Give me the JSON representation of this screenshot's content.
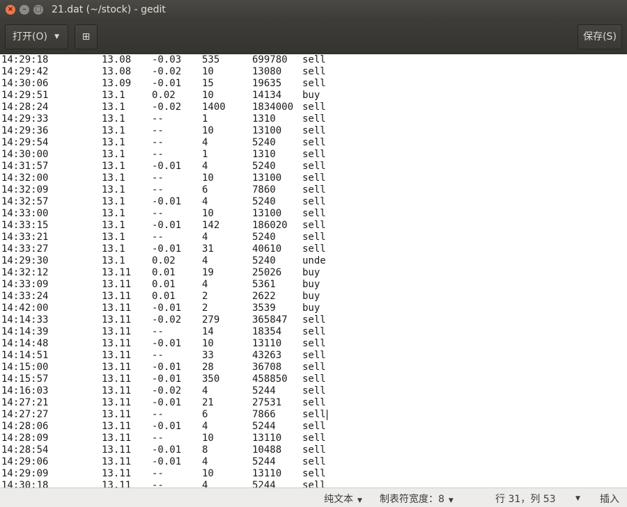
{
  "window": {
    "title": "21.dat (~/stock) - gedit",
    "close_glyph": "×",
    "min_glyph": "–",
    "max_glyph": "□"
  },
  "toolbar": {
    "open_label": "打开(O)",
    "dropdown_glyph": "▼",
    "new_tab_glyph": "⊞",
    "save_label": "保存(S)"
  },
  "editor": {
    "cursor": {
      "line": 31,
      "column": 53
    },
    "lines": [
      [
        "14:29:18",
        "13.08",
        "-0.03",
        "535",
        "699780",
        "sell"
      ],
      [
        "14:29:42",
        "13.08",
        "-0.02",
        "10",
        "13080",
        "sell"
      ],
      [
        "14:30:06",
        "13.09",
        "-0.01",
        "15",
        "19635",
        "sell"
      ],
      [
        "14:29:51",
        "13.1",
        "0.02",
        "10",
        "14134",
        "buy"
      ],
      [
        "14:28:24",
        "13.1",
        "-0.02",
        "1400",
        "1834000",
        "sell"
      ],
      [
        "14:29:33",
        "13.1",
        "--",
        "1",
        "1310",
        "sell"
      ],
      [
        "14:29:36",
        "13.1",
        "--",
        "10",
        "13100",
        "sell"
      ],
      [
        "14:29:54",
        "13.1",
        "--",
        "4",
        "5240",
        "sell"
      ],
      [
        "14:30:00",
        "13.1",
        "--",
        "1",
        "1310",
        "sell"
      ],
      [
        "14:31:57",
        "13.1",
        "-0.01",
        "4",
        "5240",
        "sell"
      ],
      [
        "14:32:00",
        "13.1",
        "--",
        "10",
        "13100",
        "sell"
      ],
      [
        "14:32:09",
        "13.1",
        "--",
        "6",
        "7860",
        "sell"
      ],
      [
        "14:32:57",
        "13.1",
        "-0.01",
        "4",
        "5240",
        "sell"
      ],
      [
        "14:33:00",
        "13.1",
        "--",
        "10",
        "13100",
        "sell"
      ],
      [
        "14:33:15",
        "13.1",
        "-0.01",
        "142",
        "186020",
        "sell"
      ],
      [
        "14:33:21",
        "13.1",
        "--",
        "4",
        "5240",
        "sell"
      ],
      [
        "14:33:27",
        "13.1",
        "-0.01",
        "31",
        "40610",
        "sell"
      ],
      [
        "14:29:30",
        "13.1",
        "0.02",
        "4",
        "5240",
        "unde"
      ],
      [
        "14:32:12",
        "13.11",
        "0.01",
        "19",
        "25026",
        "buy"
      ],
      [
        "14:33:09",
        "13.11",
        "0.01",
        "4",
        "5361",
        "buy"
      ],
      [
        "14:33:24",
        "13.11",
        "0.01",
        "2",
        "2622",
        "buy"
      ],
      [
        "14:42:00",
        "13.11",
        "-0.01",
        "2",
        "3539",
        "buy"
      ],
      [
        "14:14:33",
        "13.11",
        "-0.02",
        "279",
        "365847",
        "sell"
      ],
      [
        "14:14:39",
        "13.11",
        "--",
        "14",
        "18354",
        "sell"
      ],
      [
        "14:14:48",
        "13.11",
        "-0.01",
        "10",
        "13110",
        "sell"
      ],
      [
        "14:14:51",
        "13.11",
        "--",
        "33",
        "43263",
        "sell"
      ],
      [
        "14:15:00",
        "13.11",
        "-0.01",
        "28",
        "36708",
        "sell"
      ],
      [
        "14:15:57",
        "13.11",
        "-0.01",
        "350",
        "458850",
        "sell"
      ],
      [
        "14:16:03",
        "13.11",
        "-0.02",
        "4",
        "5244",
        "sell"
      ],
      [
        "14:27:21",
        "13.11",
        "-0.01",
        "21",
        "27531",
        "sell"
      ],
      [
        "14:27:27",
        "13.11",
        "--",
        "6",
        "7866",
        "sell"
      ],
      [
        "14:28:06",
        "13.11",
        "-0.01",
        "4",
        "5244",
        "sell"
      ],
      [
        "14:28:09",
        "13.11",
        "--",
        "10",
        "13110",
        "sell"
      ],
      [
        "14:28:54",
        "13.11",
        "-0.01",
        "8",
        "10488",
        "sell"
      ],
      [
        "14:29:06",
        "13.11",
        "-0.01",
        "4",
        "5244",
        "sell"
      ],
      [
        "14:29:09",
        "13.11",
        "--",
        "10",
        "13110",
        "sell"
      ],
      [
        "14:30:18",
        "13.11",
        "--",
        "4",
        "5244",
        "sell"
      ]
    ]
  },
  "statusbar": {
    "language_label": "纯文本",
    "tab_width_label": "制表符宽度：8",
    "position_label": "行 31，列 53",
    "mode_label": "插入",
    "arrow_glyph": "▼"
  }
}
